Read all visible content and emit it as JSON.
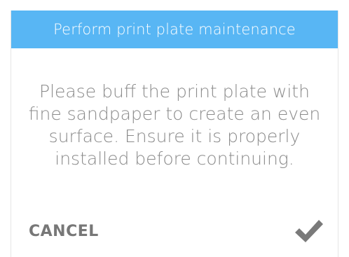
{
  "dialog": {
    "title": "Perform print plate maintenance",
    "message": "Please buff the print plate with fine sandpaper to create an even surface. Ensure it is properly installed before continuing.",
    "cancel_label": "CANCEL",
    "confirm_icon": "checkmark-icon"
  },
  "colors": {
    "header_background": "#58b6f4",
    "header_text": "#ffffff",
    "message_text": "#8b8b8b",
    "cancel_text": "#777777",
    "checkmark": "#7a7a7a"
  }
}
